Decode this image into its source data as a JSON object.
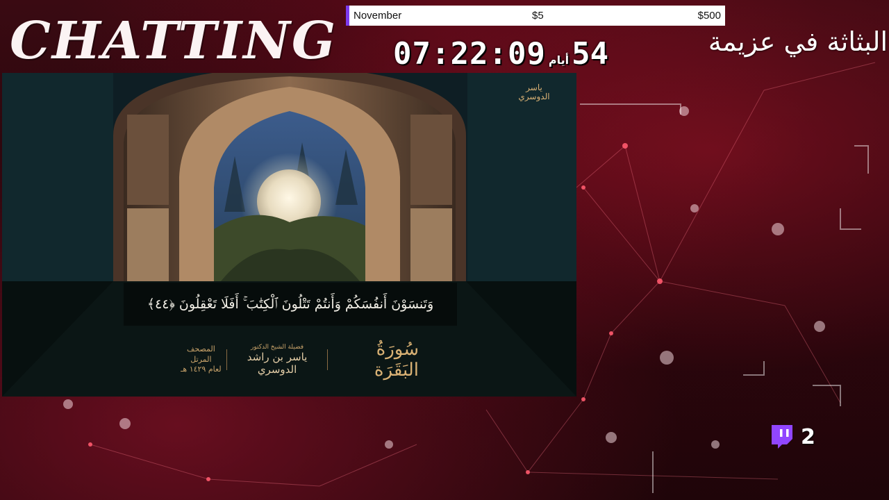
{
  "overlay": {
    "title": "CHATTING",
    "arabic_heading": "البثاثة في عزيمة"
  },
  "goal": {
    "month": "November",
    "current": "$5",
    "target": "$500",
    "accent_color": "#7c3aed",
    "progress_fraction": 0.01
  },
  "countdown": {
    "time": "07:22:09",
    "days_word": "أيام",
    "days_number": "54"
  },
  "video": {
    "verse_text": "وَتَنسَوْنَ أَنفُسَكُمْ وَأَنتُمْ تَتْلُونَ ٱلْكِتَٰبَ ۚ أَفَلَا تَعْقِلُونَ ﴿٤٤﴾",
    "surah": "سُورَةُ البَقَرَة",
    "reciter_prefix": "فضيلة الشيخ الدكتور",
    "reciter": "ياسر بن راشد الدوسري",
    "mushaf_line1": "المصحف المرتل",
    "mushaf_line2": "لعام ١٤٢٩ هـ",
    "logo_text": "ياسر الدوسري"
  },
  "twitch": {
    "icon": "twitch-icon",
    "viewer_count": "2",
    "brand_color": "#9146ff"
  }
}
